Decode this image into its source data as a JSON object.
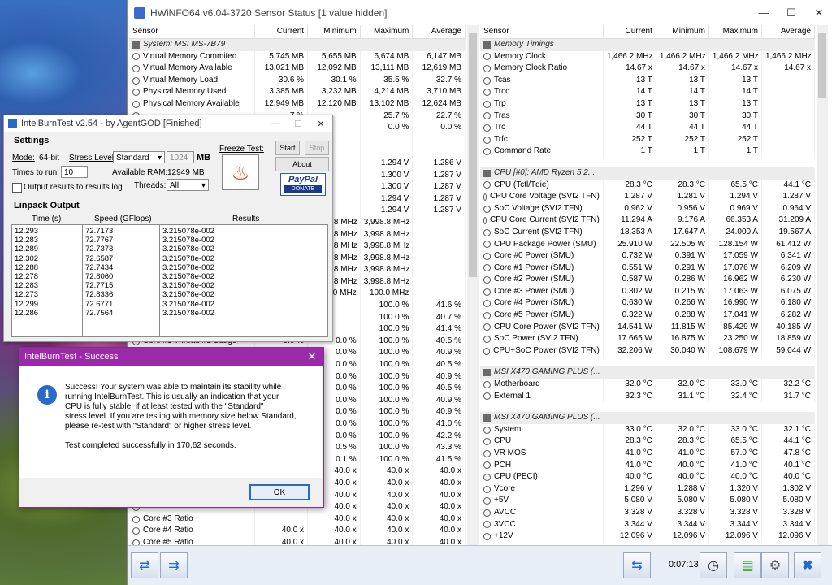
{
  "hwinfo": {
    "title": "HWiNFO64 v6.04-3720 Sensor Status [1 value hidden]",
    "columns": [
      "Sensor",
      "Current",
      "Minimum",
      "Maximum",
      "Average"
    ],
    "left_rows": [
      {
        "type": "group",
        "name": "System: MSI MS-7B79"
      },
      {
        "name": "Virtual Memory Commited",
        "cur": "5,745 MB",
        "min": "5,655 MB",
        "max": "6,674 MB",
        "avg": "6,147 MB"
      },
      {
        "name": "Virtual Memory Available",
        "cur": "13,021 MB",
        "min": "12,092 MB",
        "max": "13,111 MB",
        "avg": "12,619 MB"
      },
      {
        "name": "Virtual Memory Load",
        "cur": "30.6 %",
        "min": "30.1 %",
        "max": "35.5 %",
        "avg": "32.7 %"
      },
      {
        "name": "Physical Memory Used",
        "cur": "3,385 MB",
        "min": "3,232 MB",
        "max": "4,214 MB",
        "avg": "3,710 MB"
      },
      {
        "name": "Physical Memory Available",
        "cur": "12,949 MB",
        "min": "12,120 MB",
        "max": "13,102 MB",
        "avg": "12,624 MB"
      },
      {
        "name": "",
        "cur": "7 %",
        "min": "",
        "max": "25.7 %",
        "avg": "22.7 %"
      },
      {
        "name": "",
        "cur": "0 %",
        "min": "",
        "max": "0.0 %",
        "avg": "0.0 %"
      },
      {
        "name": "",
        "cur": "",
        "min": "",
        "max": "",
        "avg": ""
      },
      {
        "name": "",
        "cur": "",
        "min": "",
        "max": "",
        "avg": ""
      },
      {
        "name": "",
        "cur": "1 V",
        "min": "",
        "max": "1.294 V",
        "avg": "1.286 V"
      },
      {
        "name": "",
        "cur": "1 V",
        "min": "",
        "max": "1.300 V",
        "avg": "1.287 V"
      },
      {
        "name": "",
        "cur": "1 V",
        "min": "",
        "max": "1.300 V",
        "avg": "1.287 V"
      },
      {
        "name": "",
        "cur": "1 V",
        "min": "",
        "max": "1.294 V",
        "avg": "1.287 V"
      },
      {
        "name": "",
        "cur": "1 V",
        "min": "",
        "max": "1.294 V",
        "avg": "1.287 V"
      },
      {
        "name": "",
        "cur": "Hz",
        "min": "3,998.8 MHz",
        "max": "3,998.8 MHz",
        "avg": ""
      },
      {
        "name": "",
        "cur": "Hz",
        "min": "3,998.8 MHz",
        "max": "3,998.8 MHz",
        "avg": ""
      },
      {
        "name": "",
        "cur": "Hz",
        "min": "3,998.8 MHz",
        "max": "3,998.8 MHz",
        "avg": ""
      },
      {
        "name": "",
        "cur": "Hz",
        "min": "3,998.8 MHz",
        "max": "3,998.8 MHz",
        "avg": ""
      },
      {
        "name": "",
        "cur": "Hz",
        "min": "3,998.8 MHz",
        "max": "3,998.8 MHz",
        "avg": ""
      },
      {
        "name": "",
        "cur": "Hz",
        "min": "3,998.8 MHz",
        "max": "3,998.8 MHz",
        "avg": ""
      },
      {
        "name": "",
        "cur": "Hz",
        "min": "100.0 MHz",
        "max": "100.0 MHz",
        "avg": ""
      },
      {
        "name": "",
        "cur": "0 %",
        "min": "",
        "max": "100.0 %",
        "avg": "41.6 %"
      },
      {
        "name": "",
        "cur": "0 %",
        "min": "",
        "max": "100.0 %",
        "avg": "40.7 %"
      },
      {
        "name": "",
        "cur": "0 %",
        "min": "",
        "max": "100.0 %",
        "avg": "41.4 %"
      },
      {
        "name": "Core #1 Thread #1 Usage",
        "cur": "0.0 %",
        "min": "0.0 %",
        "max": "100.0 %",
        "avg": "40.5 %"
      },
      {
        "name": "",
        "cur": "",
        "min": "0.0 %",
        "max": "100.0 %",
        "avg": "40.9 %"
      },
      {
        "name": "",
        "cur": "",
        "min": "0.0 %",
        "max": "100.0 %",
        "avg": "40.5 %"
      },
      {
        "name": "",
        "cur": "",
        "min": "0.0 %",
        "max": "100.0 %",
        "avg": "40.9 %"
      },
      {
        "name": "",
        "cur": "",
        "min": "0.0 %",
        "max": "100.0 %",
        "avg": "40.5 %"
      },
      {
        "name": "",
        "cur": "",
        "min": "0.0 %",
        "max": "100.0 %",
        "avg": "40.9 %"
      },
      {
        "name": "",
        "cur": "",
        "min": "0.0 %",
        "max": "100.0 %",
        "avg": "40.9 %"
      },
      {
        "name": "",
        "cur": "",
        "min": "0.0 %",
        "max": "100.0 %",
        "avg": "41.0 %"
      },
      {
        "name": "",
        "cur": "",
        "min": "0.0 %",
        "max": "100.0 %",
        "avg": "42.2 %"
      },
      {
        "name": "",
        "cur": "",
        "min": "0.5 %",
        "max": "100.0 %",
        "avg": "43.3 %"
      },
      {
        "name": "",
        "cur": "",
        "min": "0.1 %",
        "max": "100.0 %",
        "avg": "41.5 %"
      },
      {
        "name": "",
        "cur": "",
        "min": "40.0 x",
        "max": "40.0 x",
        "avg": "40.0 x"
      },
      {
        "name": "",
        "cur": "",
        "min": "40.0 x",
        "max": "40.0 x",
        "avg": "40.0 x"
      },
      {
        "name": "",
        "cur": "",
        "min": "40.0 x",
        "max": "40.0 x",
        "avg": "40.0 x"
      },
      {
        "name": "",
        "cur": "",
        "min": "40.0 x",
        "max": "40.0 x",
        "avg": "40.0 x"
      },
      {
        "name": "Core #3 Ratio",
        "cur": "",
        "min": "40.0 x",
        "max": "40.0 x",
        "avg": "40.0 x"
      },
      {
        "name": "Core #4 Ratio",
        "cur": "40.0 x",
        "min": "40.0 x",
        "max": "40.0 x",
        "avg": "40.0 x"
      },
      {
        "name": "Core #5 Ratio",
        "cur": "40.0 x",
        "min": "40.0 x",
        "max": "40.0 x",
        "avg": "40.0 x"
      }
    ],
    "right_rows": [
      {
        "type": "group",
        "name": "Memory Timings"
      },
      {
        "name": "Memory Clock",
        "cur": "1,466.2 MHz",
        "min": "1,466.2 MHz",
        "max": "1,466.2 MHz",
        "avg": "1,466.2 MHz"
      },
      {
        "name": "Memory Clock Ratio",
        "cur": "14.67 x",
        "min": "14.67 x",
        "max": "14.67 x",
        "avg": "14.67 x"
      },
      {
        "name": "Tcas",
        "cur": "13 T",
        "min": "13 T",
        "max": "13 T",
        "avg": ""
      },
      {
        "name": "Trcd",
        "cur": "14 T",
        "min": "14 T",
        "max": "14 T",
        "avg": ""
      },
      {
        "name": "Trp",
        "cur": "13 T",
        "min": "13 T",
        "max": "13 T",
        "avg": ""
      },
      {
        "name": "Tras",
        "cur": "30 T",
        "min": "30 T",
        "max": "30 T",
        "avg": ""
      },
      {
        "name": "Trc",
        "cur": "44 T",
        "min": "44 T",
        "max": "44 T",
        "avg": ""
      },
      {
        "name": "Trfc",
        "cur": "252 T",
        "min": "252 T",
        "max": "252 T",
        "avg": ""
      },
      {
        "name": "Command Rate",
        "cur": "1 T",
        "min": "1 T",
        "max": "1 T",
        "avg": ""
      },
      {
        "type": "spacer"
      },
      {
        "type": "group",
        "name": "CPU [#0]: AMD Ryzen 5 2..."
      },
      {
        "name": "CPU (Tctl/Tdie)",
        "cur": "28.3 °C",
        "min": "28.3 °C",
        "max": "65.5 °C",
        "avg": "44.1 °C"
      },
      {
        "name": "CPU Core Voltage (SVI2 TFN)",
        "cur": "1.287 V",
        "min": "1.281 V",
        "max": "1.294 V",
        "avg": "1.287 V"
      },
      {
        "name": "SoC Voltage (SVI2 TFN)",
        "cur": "0.962 V",
        "min": "0.956 V",
        "max": "0.969 V",
        "avg": "0.964 V"
      },
      {
        "name": "CPU Core Current (SVI2 TFN)",
        "cur": "11.294 A",
        "min": "9.176 A",
        "max": "66.353 A",
        "avg": "31.209 A"
      },
      {
        "name": "SoC Current (SVI2 TFN)",
        "cur": "18.353 A",
        "min": "17.647 A",
        "max": "24.000 A",
        "avg": "19.567 A"
      },
      {
        "name": "CPU Package Power (SMU)",
        "cur": "25.910 W",
        "min": "22.505 W",
        "max": "128.154 W",
        "avg": "61.412 W"
      },
      {
        "name": "Core #0 Power (SMU)",
        "cur": "0.732 W",
        "min": "0.391 W",
        "max": "17.059 W",
        "avg": "6.341 W"
      },
      {
        "name": "Core #1 Power (SMU)",
        "cur": "0.551 W",
        "min": "0.291 W",
        "max": "17.076 W",
        "avg": "6.209 W"
      },
      {
        "name": "Core #2 Power (SMU)",
        "cur": "0.587 W",
        "min": "0.286 W",
        "max": "16.962 W",
        "avg": "6.230 W"
      },
      {
        "name": "Core #3 Power (SMU)",
        "cur": "0.302 W",
        "min": "0.215 W",
        "max": "17.063 W",
        "avg": "6.075 W"
      },
      {
        "name": "Core #4 Power (SMU)",
        "cur": "0.630 W",
        "min": "0.266 W",
        "max": "16.990 W",
        "avg": "6.180 W"
      },
      {
        "name": "Core #5 Power (SMU)",
        "cur": "0.322 W",
        "min": "0.288 W",
        "max": "17.041 W",
        "avg": "6.282 W"
      },
      {
        "name": "CPU Core Power (SVI2 TFN)",
        "cur": "14.541 W",
        "min": "11.815 W",
        "max": "85.429 W",
        "avg": "40.185 W"
      },
      {
        "name": "SoC Power (SVI2 TFN)",
        "cur": "17.665 W",
        "min": "16.875 W",
        "max": "23.250 W",
        "avg": "18.859 W"
      },
      {
        "name": "CPU+SoC Power (SVI2 TFN)",
        "cur": "32.206 W",
        "min": "30.040 W",
        "max": "108.679 W",
        "avg": "59.044 W"
      },
      {
        "type": "spacer"
      },
      {
        "type": "group",
        "name": "MSI X470 GAMING PLUS (..."
      },
      {
        "name": "Motherboard",
        "cur": "32.0 °C",
        "min": "32.0 °C",
        "max": "33.0 °C",
        "avg": "32.2 °C"
      },
      {
        "name": "External 1",
        "cur": "32.3 °C",
        "min": "31.1 °C",
        "max": "32.4 °C",
        "avg": "31.7 °C"
      },
      {
        "type": "spacer"
      },
      {
        "type": "group",
        "name": "MSI X470 GAMING PLUS (..."
      },
      {
        "name": "System",
        "cur": "33.0 °C",
        "min": "32.0 °C",
        "max": "33.0 °C",
        "avg": "32.1 °C"
      },
      {
        "name": "CPU",
        "cur": "28.3 °C",
        "min": "28.3 °C",
        "max": "65.5 °C",
        "avg": "44.1 °C"
      },
      {
        "name": "VR MOS",
        "cur": "41.0 °C",
        "min": "41.0 °C",
        "max": "57.0 °C",
        "avg": "47.8 °C"
      },
      {
        "name": "PCH",
        "cur": "41.0 °C",
        "min": "40.0 °C",
        "max": "41.0 °C",
        "avg": "40.1 °C"
      },
      {
        "name": "CPU (PECI)",
        "cur": "40.0 °C",
        "min": "40.0 °C",
        "max": "40.0 °C",
        "avg": "40.0 °C"
      },
      {
        "name": "Vcore",
        "cur": "1.296 V",
        "min": "1.288 V",
        "max": "1.320 V",
        "avg": "1.302 V"
      },
      {
        "name": "+5V",
        "cur": "5.080 V",
        "min": "5.080 V",
        "max": "5.080 V",
        "avg": "5.080 V"
      },
      {
        "name": "AVCC",
        "cur": "3.328 V",
        "min": "3.328 V",
        "max": "3.328 V",
        "avg": "3.328 V"
      },
      {
        "name": "3VCC",
        "cur": "3.344 V",
        "min": "3.344 V",
        "max": "3.344 V",
        "avg": "3.344 V"
      },
      {
        "name": "+12V",
        "cur": "12.096 V",
        "min": "12.096 V",
        "max": "12.096 V",
        "avg": "12.096 V"
      }
    ],
    "timer": "0:07:13"
  },
  "ibt": {
    "title": "IntelBurnTest v2.54 - by AgentGOD [Finished]",
    "settings_label": "Settings",
    "mode_label": "Mode:",
    "mode_value": "64-bit",
    "stress_label": "Stress Level:",
    "stress_value": "Standard",
    "mb_value": "1024",
    "mb_unit": "MB",
    "times_label": "Times to run:",
    "times_value": "10",
    "ram_label": "Available RAM:",
    "ram_value": "12949 MB",
    "output_label": "Output results to results.log",
    "threads_label": "Threads:",
    "threads_value": "All",
    "freeze_label": "Freeze Test:",
    "start_label": "Start",
    "stop_label": "Stop",
    "about_label": "About",
    "paypal_label": "PayPal",
    "donate_label": "DONATE",
    "linpack_label": "Linpack Output",
    "col_time": "Time (s)",
    "col_speed": "Speed (GFlops)",
    "col_results": "Results",
    "times": [
      "12.293",
      "12.283",
      "12.289",
      "12.302",
      "12.288",
      "12.278",
      "12.283",
      "12.273",
      "12.299",
      "12.286"
    ],
    "speeds": [
      "72.7173",
      "72.7767",
      "72.7373",
      "72.6587",
      "72.7434",
      "72.8060",
      "72.7715",
      "72.8336",
      "72.6771",
      "72.7564"
    ],
    "results": [
      "3.215078e-002",
      "3.215078e-002",
      "3.215078e-002",
      "3.215078e-002",
      "3.215078e-002",
      "3.215078e-002",
      "3.215078e-002",
      "3.215078e-002",
      "3.215078e-002",
      "3.215078e-002"
    ]
  },
  "dialog": {
    "title": "IntelBurnTest - Success",
    "message_lines": [
      "Success! Your system was able to maintain its stability while",
      "running IntelBurnTest. This is usually an indication that your",
      "CPU is fully stable, if at least tested with the \"Standard\"",
      "stress level. If you are testing with memory size below Standard,",
      "please re-test with \"Standard\" or higher stress level.",
      "",
      "Test completed successfully in 170,62 seconds."
    ],
    "ok_label": "OK"
  }
}
